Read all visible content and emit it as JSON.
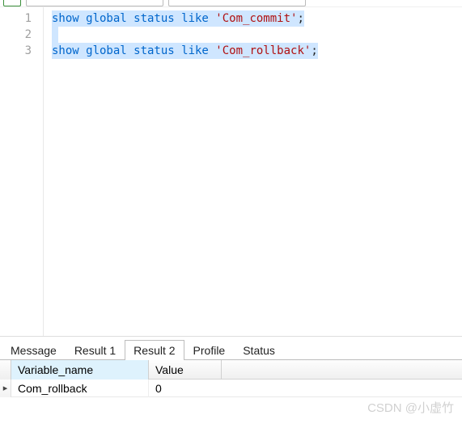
{
  "editor": {
    "line_numbers": [
      "1",
      "2",
      "3"
    ],
    "lines": [
      {
        "kw": "show global status like ",
        "str": "'Com_commit'",
        "tail": ";"
      },
      {
        "kw": "",
        "str": "",
        "tail": ""
      },
      {
        "kw": "show global status like ",
        "str": "'Com_rollback'",
        "tail": ";"
      }
    ]
  },
  "tabs": {
    "message": "Message",
    "result1": "Result 1",
    "result2": "Result 2",
    "profile": "Profile",
    "status": "Status",
    "active": "result2"
  },
  "grid": {
    "headers": {
      "variable_name": "Variable_name",
      "value": "Value"
    },
    "row_indicator": "▸",
    "rows": [
      {
        "variable_name": "Com_rollback",
        "value": "0"
      }
    ]
  },
  "watermark": "CSDN @小虚竹"
}
